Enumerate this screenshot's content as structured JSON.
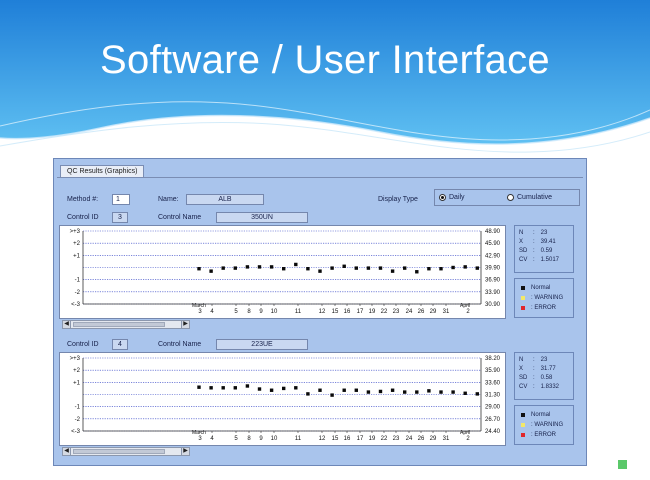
{
  "slide": {
    "title": "Software / User Interface",
    "colors": {
      "accent": "#3ba3e6",
      "deep": "#1b74c9",
      "bullet": "#5bc86a"
    }
  },
  "window": {
    "tab_label": "QC Results (Graphics)",
    "method_label": "Method #:",
    "method_value": "1",
    "name_label": "Name:",
    "name_value": "ALB",
    "display_type_label": "Display Type",
    "daily_label": "Daily",
    "cumulative_label": "Cumulative",
    "selected_display": "Daily"
  },
  "panels": [
    {
      "control_id_label": "Control ID",
      "control_id": "3",
      "control_name_label": "Control Name",
      "control_name": "350UN",
      "sd_labels": [
        "+3",
        "+2",
        "+1",
        "-1",
        "-2",
        "-3"
      ],
      "sd_top_label": ">+3",
      "sd_bottom_label": "<-3",
      "right_labels": [
        "48.90",
        "45.90",
        "42.90",
        "39.90",
        "36.90",
        "33.90",
        "30.90"
      ],
      "stats": {
        "n_label": "N",
        "n": "23",
        "x_label": "X",
        "x": "39.41",
        "sd_label": "SD",
        "sd": "0.59",
        "cv_label": "CV",
        "cv": "1.5017"
      },
      "legend": {
        "normal": "Normal",
        "warning": "WARNING",
        "error": "ERROR"
      },
      "x_labels": [
        "3",
        "4",
        "5",
        "8",
        "9",
        "10",
        "11",
        "12",
        "15",
        "16",
        "17",
        "19",
        "22",
        "23",
        "24",
        "26",
        "29",
        "31",
        "2"
      ],
      "month_start": "March",
      "month_end": "April",
      "chart_data": {
        "type": "scatter",
        "y_axis": "standard deviations from mean",
        "ylim": [
          -3,
          3
        ],
        "points_sd": [
          -0.1,
          -0.3,
          -0.05,
          -0.05,
          0.05,
          0.05,
          0.05,
          -0.1,
          0.25,
          -0.1,
          -0.3,
          -0.05,
          0.1,
          -0.05,
          -0.05,
          -0.05,
          -0.3,
          -0.05,
          -0.35,
          -0.1,
          -0.1,
          0.0,
          0.05,
          -0.05
        ]
      }
    },
    {
      "control_id_label": "Control ID",
      "control_id": "4",
      "control_name_label": "Control Name",
      "control_name": "223UE",
      "sd_labels": [
        "+3",
        "+2",
        "+1",
        "-1",
        "-2",
        "-3"
      ],
      "sd_top_label": ">+3",
      "sd_bottom_label": "<-3",
      "right_labels": [
        "38.20",
        "35.90",
        "33.60",
        "31.30",
        "29.00",
        "26.70",
        "24.40"
      ],
      "stats": {
        "n_label": "N",
        "n": "23",
        "x_label": "X",
        "x": "31.77",
        "sd_label": "SD",
        "sd": "0.58",
        "cv_label": "CV",
        "cv": "1.8332"
      },
      "legend": {
        "normal": "Normal",
        "warning": "WARNING",
        "error": "ERROR"
      },
      "x_labels": [
        "3",
        "4",
        "5",
        "8",
        "9",
        "10",
        "11",
        "12",
        "15",
        "16",
        "17",
        "19",
        "22",
        "23",
        "24",
        "26",
        "29",
        "31",
        "2"
      ],
      "month_start": "March",
      "month_end": "April",
      "chart_data": {
        "type": "scatter",
        "y_axis": "standard deviations from mean",
        "ylim": [
          -3,
          3
        ],
        "points_sd": [
          0.6,
          0.55,
          0.55,
          0.55,
          0.7,
          0.45,
          0.35,
          0.5,
          0.55,
          0.05,
          0.35,
          -0.05,
          0.35,
          0.35,
          0.2,
          0.25,
          0.35,
          0.2,
          0.2,
          0.3,
          0.2,
          0.2,
          0.1,
          0.05
        ]
      }
    }
  ]
}
